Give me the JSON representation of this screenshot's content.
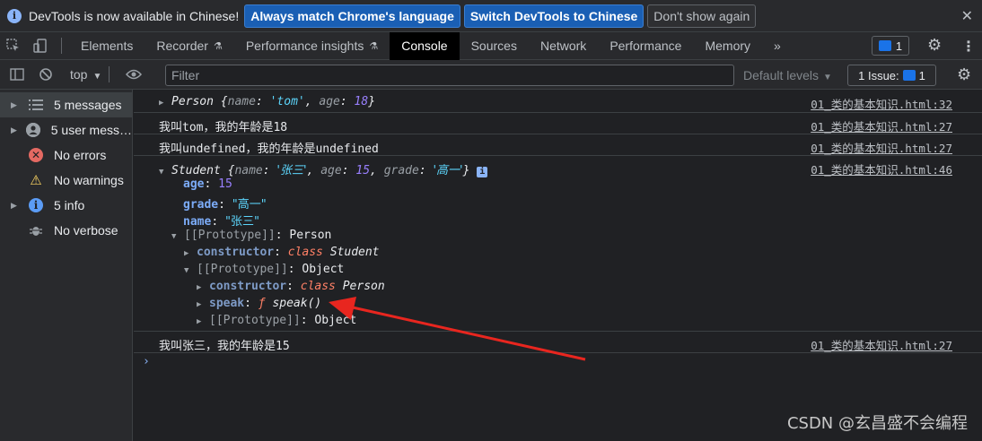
{
  "infobar": {
    "message": "DevTools is now available in Chinese!",
    "btn_match": "Always match Chrome's language",
    "btn_switch": "Switch DevTools to Chinese",
    "btn_dismiss": "Don't show again",
    "close": "✕"
  },
  "tabs": [
    "Elements",
    "Recorder",
    "Performance insights",
    "Console",
    "Sources",
    "Network",
    "Performance",
    "Memory"
  ],
  "active_tab": "Console",
  "more_tabs": "»",
  "messages_badge": "1",
  "toolbar": {
    "context": "top",
    "filter_placeholder": "Filter",
    "levels": "Default levels",
    "issues_label": "1 Issue:",
    "issues_count": "1"
  },
  "sidebar": [
    {
      "label": "5 messages",
      "icon": "list-icon"
    },
    {
      "label": "5 user mess…",
      "icon": "user-icon"
    },
    {
      "label": "No errors",
      "icon": "error-icon"
    },
    {
      "label": "No warnings",
      "icon": "warning-icon"
    },
    {
      "label": "5 info",
      "icon": "info-icon"
    },
    {
      "label": "No verbose",
      "icon": "bug-icon"
    }
  ],
  "console": {
    "row1": {
      "name": "Person",
      "k1": "name",
      "v1": "'tom'",
      "k2": "age",
      "v2": "18",
      "src": "01_类的基本知识.html:32"
    },
    "row2": {
      "text": "我叫tom，我的年龄是18",
      "src": "01_类的基本知识.html:27"
    },
    "row3": {
      "text": "我叫undefined，我的年龄是undefined",
      "src": "01_类的基本知识.html:27"
    },
    "row4": {
      "name": "Student",
      "k1": "name",
      "v1": "'张三'",
      "k2": "age",
      "v2": "15",
      "k3": "grade",
      "v3": "'高一'",
      "src": "01_类的基本知识.html:46",
      "age_key": "age",
      "age_val": "15",
      "grade_key": "grade",
      "grade_val": "\"高一\"",
      "name_key": "name",
      "name_val": "\"张三\"",
      "proto1": "[[Prototype]]",
      "proto1_val": "Person",
      "ctor1": "constructor",
      "ctor1_kw": "class",
      "ctor1_name": "Student",
      "proto2": "[[Prototype]]",
      "proto2_val": "Object",
      "ctor2": "constructor",
      "ctor2_kw": "class",
      "ctor2_name": "Person",
      "speak": "speak",
      "speak_f": "ƒ",
      "speak_val": "speak()",
      "proto3": "[[Prototype]]",
      "proto3_val": "Object"
    },
    "row5": {
      "text": "我叫张三，我的年龄是15",
      "src": "01_类的基本知识.html:27"
    }
  },
  "watermark": "CSDN @玄昌盛不会编程",
  "colors": {
    "arrow": "#e8261f",
    "accent": "#1a73e8"
  }
}
